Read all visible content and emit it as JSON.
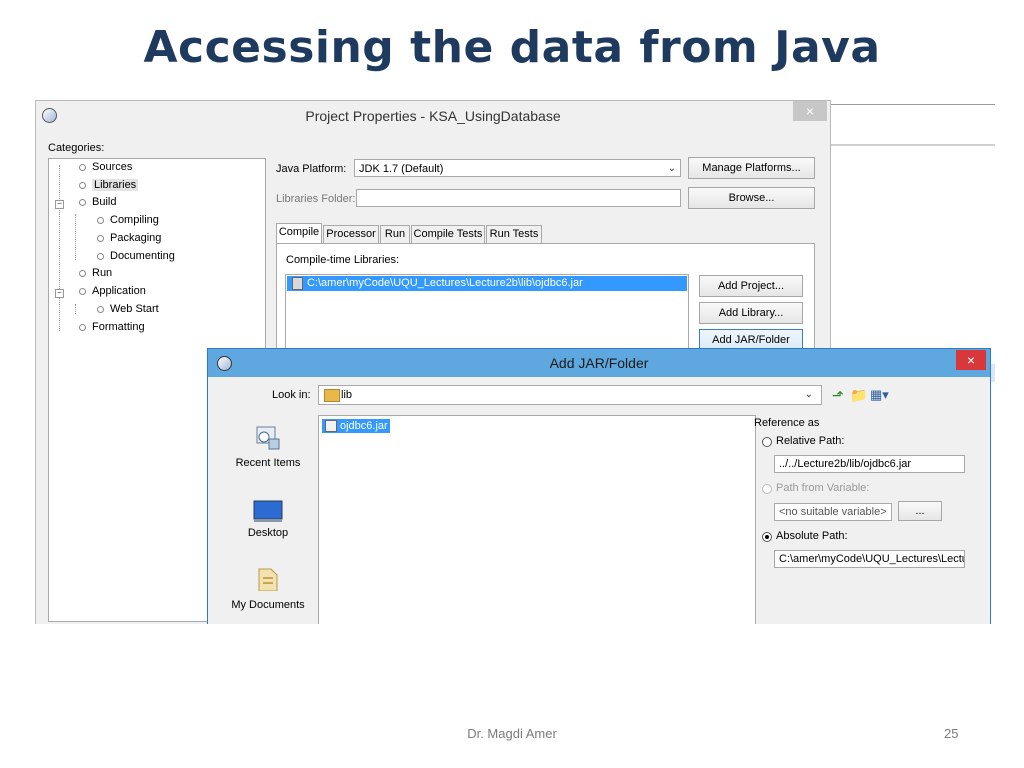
{
  "slide": {
    "title": "Accessing the data from Java",
    "footer_author": "Dr. Magdi Amer",
    "page_number": "25"
  },
  "project_properties": {
    "title": "Project Properties - KSA_UsingDatabase",
    "close_glyph": "×",
    "categories_label": "Categories:",
    "categories": [
      {
        "label": "Sources"
      },
      {
        "label": "Libraries",
        "selected": true
      },
      {
        "label": "Build"
      },
      {
        "label": "Compiling"
      },
      {
        "label": "Packaging"
      },
      {
        "label": "Documenting"
      },
      {
        "label": "Run"
      },
      {
        "label": "Application"
      },
      {
        "label": "Web Start"
      },
      {
        "label": "Formatting"
      }
    ],
    "java_platform_label": "Java Platform:",
    "java_platform_value": "JDK 1.7 (Default)",
    "manage_platforms_button": "Manage Platforms...",
    "libraries_folder_label": "Libraries Folder:",
    "libraries_folder_value": "",
    "browse_button": "Browse...",
    "tabs": [
      {
        "label": "Compile",
        "active": true
      },
      {
        "label": "Processor"
      },
      {
        "label": "Run"
      },
      {
        "label": "Compile Tests"
      },
      {
        "label": "Run Tests"
      }
    ],
    "compile_time_libraries_label": "Compile-time Libraries:",
    "libraries": [
      {
        "path": "C:\\amer\\myCode\\UQU_Lectures\\Lecture2b\\lib\\ojdbc6.jar",
        "selected": true
      }
    ],
    "add_project_button": "Add Project...",
    "add_library_button": "Add Library...",
    "add_jar_folder_button": "Add JAR/Folder"
  },
  "add_jar_dialog": {
    "title": "Add JAR/Folder",
    "close_glyph": "×",
    "look_in_label": "Look in:",
    "look_in_value": "lib",
    "places": [
      {
        "label": "Recent Items",
        "icon": "recent-items-icon"
      },
      {
        "label": "Desktop",
        "icon": "desktop-icon"
      },
      {
        "label": "My Documents",
        "icon": "my-documents-icon"
      }
    ],
    "files": [
      {
        "name": "ojdbc6.jar",
        "selected": true
      }
    ],
    "reference_as_label": "Reference as",
    "relative_path_label": "Relative Path:",
    "relative_path_value": "../../Lecture2b/lib/ojdbc6.jar",
    "path_from_variable_label": "Path from Variable:",
    "variable_value": "<no suitable variable>",
    "variable_button": "...",
    "absolute_path_label": "Absolute Path:",
    "absolute_path_value": "C:\\amer\\myCode\\UQU_Lectures\\Lectu",
    "selected_reference": "absolute",
    "colors": {
      "titlebar": "#5ea8df",
      "close": "#d8383c",
      "selection": "#3399ff"
    }
  }
}
